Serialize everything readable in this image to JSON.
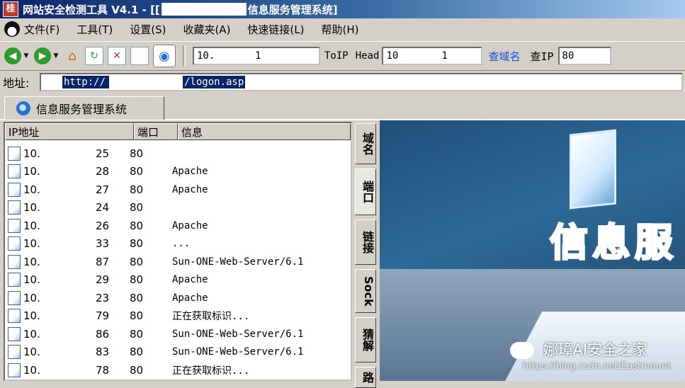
{
  "window": {
    "app_icon_text": "桂",
    "title_prefix": "网站安全检测工具 V4.1 - [[",
    "title_suffix": "信息服务管理系统]"
  },
  "menu": [
    "文件(F)",
    "工具(T)",
    "设置(S)",
    "收藏夹(A)",
    "快速链接(L)",
    "帮助(H)"
  ],
  "toolbar": {
    "ip_field_start": "10.",
    "ip_field_end": "1",
    "toip_label": "ToIP",
    "head_label": "Head",
    "head_field_start": "10",
    "head_field_end": "1",
    "lookup_domain_link": "查域名",
    "lookup_ip_label": "查IP",
    "port_field": "80"
  },
  "address": {
    "label": "地址:",
    "value_start": "http://",
    "value_end": "/logon.asp"
  },
  "tabs": [
    {
      "label": "信息服务管理系统"
    }
  ],
  "table": {
    "columns": [
      "IP地址",
      "端口",
      "信息"
    ],
    "rows": [
      {
        "ip_start": "10.",
        "ip_end": "25",
        "port": "80",
        "info": ""
      },
      {
        "ip_start": "10.",
        "ip_end": "28",
        "port": "80",
        "info": "Apache"
      },
      {
        "ip_start": "10.",
        "ip_end": "27",
        "port": "80",
        "info": "Apache"
      },
      {
        "ip_start": "10.",
        "ip_end": "24",
        "port": "80",
        "info": ""
      },
      {
        "ip_start": "10.",
        "ip_end": "26",
        "port": "80",
        "info": "Apache"
      },
      {
        "ip_start": "10.",
        "ip_end": "33",
        "port": "80",
        "info": "..."
      },
      {
        "ip_start": "10.",
        "ip_end": "87",
        "port": "80",
        "info": "Sun-ONE-Web-Server/6.1"
      },
      {
        "ip_start": "10.",
        "ip_end": "29",
        "port": "80",
        "info": "Apache"
      },
      {
        "ip_start": "10.",
        "ip_end": "23",
        "port": "80",
        "info": "Apache"
      },
      {
        "ip_start": "10.",
        "ip_end": "79",
        "port": "80",
        "info": "正在获取标识..."
      },
      {
        "ip_start": "10.",
        "ip_end": "86",
        "port": "80",
        "info": "Sun-ONE-Web-Server/6.1"
      },
      {
        "ip_start": "10.",
        "ip_end": "83",
        "port": "80",
        "info": "Sun-ONE-Web-Server/6.1"
      },
      {
        "ip_start": "10.",
        "ip_end": "78",
        "port": "80",
        "info": "正在获取标识..."
      }
    ]
  },
  "side_tabs": [
    "域名",
    "端口",
    "链接",
    "Sock",
    "猜解",
    "路"
  ],
  "webpage": {
    "banner_text": "信息服"
  },
  "watermark": {
    "text": "娜璋AI安全之家",
    "url": "https://blog.csdn.net/Eastmount"
  },
  "icons": [
    "penguin-icon",
    "back-icon",
    "forward-icon",
    "home-icon",
    "refresh-icon",
    "stop-icon",
    "page-icon",
    "globe-icon",
    "ie-icon",
    "document-icon"
  ]
}
